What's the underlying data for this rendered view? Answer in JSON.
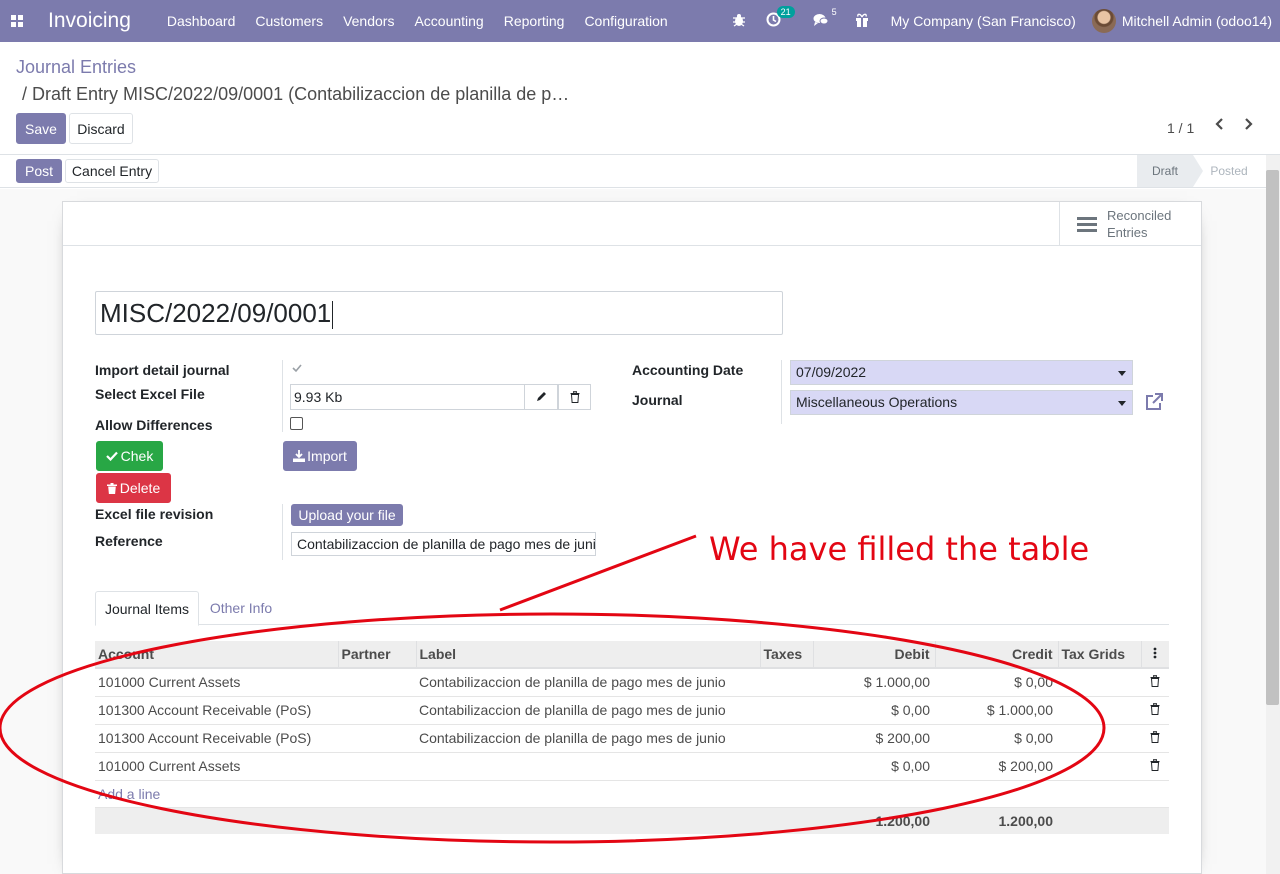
{
  "navbar": {
    "brand": "Invoicing",
    "menu": [
      "Dashboard",
      "Customers",
      "Vendors",
      "Accounting",
      "Reporting",
      "Configuration"
    ],
    "activity_badge": "21",
    "messages_badge": "5",
    "company": "My Company (San Francisco)",
    "user": "Mitchell Admin (odoo14)"
  },
  "breadcrumb": {
    "parent": "Journal Entries",
    "current": "/ Draft Entry MISC/2022/09/0001 (Contabilizaccion de planilla de p…"
  },
  "controls": {
    "save": "Save",
    "discard": "Discard",
    "pager": "1 / 1"
  },
  "statusbar": {
    "post": "Post",
    "cancel_entry": "Cancel Entry",
    "stages": [
      "Draft",
      "Posted"
    ],
    "active_stage": "Draft"
  },
  "button_box": {
    "reconciled_line1": "Reconciled",
    "reconciled_line2": "Entries"
  },
  "form": {
    "name": "MISC/2022/09/0001",
    "import_detail_label": "Import detail journal",
    "import_detail_checked": true,
    "select_excel_label": "Select Excel File",
    "file_size": "9.93 Kb",
    "allow_diff_label": "Allow Differences",
    "allow_diff_checked": false,
    "chek_btn": "Chek",
    "delete_btn": "Delete",
    "import_btn": "Import",
    "excel_revision_label": "Excel file revision",
    "upload_btn": "Upload your file",
    "reference_label": "Reference",
    "reference_value": "Contabilizaccion de planilla de pago mes de junio",
    "accounting_date_label": "Accounting Date",
    "accounting_date": "07/09/2022",
    "journal_label": "Journal",
    "journal": "Miscellaneous Operations"
  },
  "annotation": {
    "text": "We have filled the table",
    "color": "#e30613"
  },
  "tabs": {
    "journal_items": "Journal Items",
    "other_info": "Other Info"
  },
  "table": {
    "columns": [
      "Account",
      "Partner",
      "Label",
      "Taxes",
      "Debit",
      "Credit",
      "Tax Grids"
    ],
    "rows": [
      {
        "account": "101000 Current Assets",
        "partner": "",
        "label": "Contabilizaccion de planilla de pago mes de junio",
        "taxes": "",
        "debit": "$ 1.000,00",
        "credit": "$ 0,00",
        "tax_grids": ""
      },
      {
        "account": "101300 Account Receivable (PoS)",
        "partner": "",
        "label": "Contabilizaccion de planilla de pago mes de junio",
        "taxes": "",
        "debit": "$ 0,00",
        "credit": "$ 1.000,00",
        "tax_grids": ""
      },
      {
        "account": "101300 Account Receivable (PoS)",
        "partner": "",
        "label": "Contabilizaccion de planilla de pago mes de junio",
        "taxes": "",
        "debit": "$ 200,00",
        "credit": "$ 0,00",
        "tax_grids": ""
      },
      {
        "account": "101000 Current Assets",
        "partner": "",
        "label": "",
        "taxes": "",
        "debit": "$ 0,00",
        "credit": "$ 200,00",
        "tax_grids": ""
      }
    ],
    "add_line": "Add a line",
    "total_debit": "1.200,00",
    "total_credit": "1.200,00"
  },
  "colors": {
    "brand": "#7c7bad",
    "success": "#28a745",
    "danger": "#dc3545",
    "select_bg": "#d8d8f5"
  }
}
